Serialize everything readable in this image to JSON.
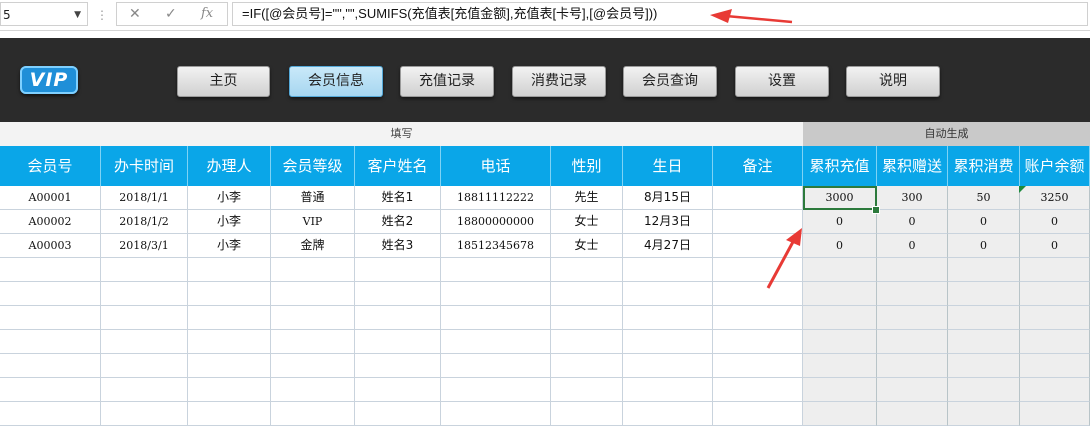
{
  "formula_bar": {
    "name_box": "5",
    "separator": "⋮",
    "cancel_symbol": "✕",
    "enter_symbol": "✓",
    "fx_symbol": "fx",
    "formula": "=IF([@会员号]=\"\",\"\",SUMIFS(充值表[充值金额],充值表[卡号],[@会员号]))"
  },
  "header": {
    "logo_text": "VIP",
    "nav": [
      "主页",
      "会员信息",
      "充值记录",
      "消费记录",
      "会员查询",
      "设置",
      "说明"
    ],
    "active_nav": "会员信息"
  },
  "sheet": {
    "band_fill": "填写",
    "band_auto": "自动生成",
    "columns": [
      "会员号",
      "办卡时间",
      "办理人",
      "会员等级",
      "客户姓名",
      "电话",
      "性别",
      "生日",
      "备注",
      "累积充值",
      "累积赠送",
      "累积消费",
      "账户余额"
    ],
    "rows": [
      [
        "A00001",
        "2018/1/1",
        "小李",
        "普通",
        "姓名1",
        "18811112222",
        "先生",
        "8月15日",
        "",
        "3000",
        "300",
        "50",
        "3250"
      ],
      [
        "A00002",
        "2018/1/2",
        "小李",
        "VIP",
        "姓名2",
        "18800000000",
        "女士",
        "12月3日",
        "",
        "0",
        "0",
        "0",
        "0"
      ],
      [
        "A00003",
        "2018/3/1",
        "小李",
        "金牌",
        "姓名3",
        "18512345678",
        "女士",
        "4月27日",
        "",
        "0",
        "0",
        "0",
        "0"
      ]
    ],
    "selected_cell_value": "3000"
  },
  "colors": {
    "header_blue": "#0aa6e8",
    "dark_bar": "#2b2b2b",
    "auto_gray": "#eeeeee",
    "arrow_red": "#e83a35"
  }
}
